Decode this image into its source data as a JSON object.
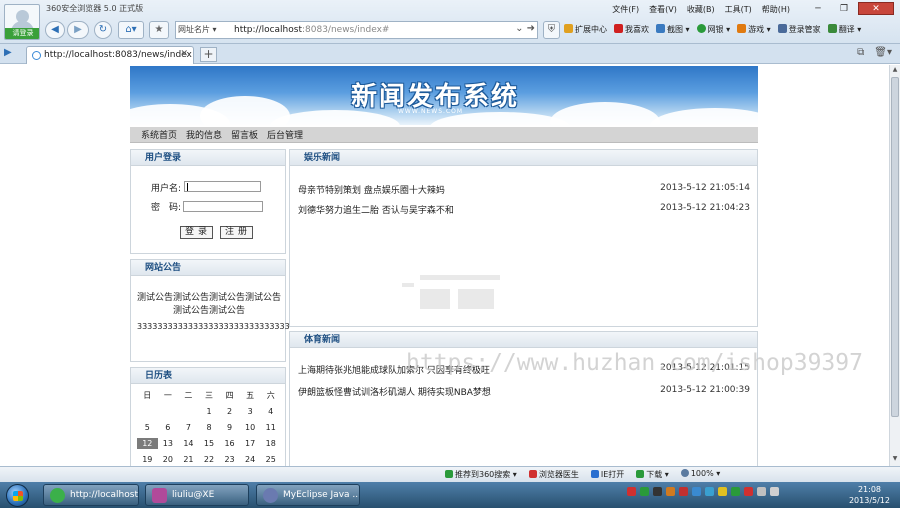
{
  "browser": {
    "login_badge": "请登录",
    "app_title": "360安全浏览器 5.0 正式版",
    "menus": [
      "文件(F)",
      "查看(V)",
      "收藏(B)",
      "工具(T)",
      "帮助(H)"
    ],
    "window_controls": [
      "─",
      "❐",
      "✕"
    ],
    "addr_sites": "网址名片 ▾",
    "url_host": "http://localhost",
    "url_rest": ":8083/news/index#",
    "toolbar": [
      "扩展中心",
      "我喜欢",
      "截图 ▾",
      "网银 ▾",
      "游戏 ▾",
      "登录管家",
      "翻译 ▾"
    ],
    "tab_label": "http://localhost:8083/news/index",
    "tab_close": "✕",
    "tab_new": "+"
  },
  "site": {
    "banner_title": "新闻发布系统",
    "banner_sub": "WWW.NEWS.COM",
    "nav": [
      "系统首页",
      "我的信息",
      "留言板",
      "后台管理"
    ]
  },
  "login": {
    "title": "用户登录",
    "username_label": "用户名:",
    "password_label": "密　码:",
    "login_btn": "登录",
    "register_btn": "注册"
  },
  "notice": {
    "title": "网站公告",
    "text": "测试公告测试公告测试公告测试公告测试公告测试公告",
    "number": "333333333333333333333333333333"
  },
  "calendar": {
    "title": "日历表",
    "headers": [
      "日",
      "一",
      "二",
      "三",
      "四",
      "五",
      "六"
    ],
    "days": [
      "",
      "",
      "",
      "1",
      "2",
      "3",
      "4",
      "5",
      "6",
      "7",
      "8",
      "9",
      "10",
      "11",
      "12",
      "13",
      "14",
      "15",
      "16",
      "17",
      "18",
      "19",
      "20",
      "21",
      "22",
      "23",
      "24",
      "25"
    ],
    "today": "12"
  },
  "entertainment": {
    "title": "娱乐新闻",
    "items": [
      {
        "title": "母亲节特别策划 盘点娱乐圈十大辣妈",
        "time": "2013-5-12 21:05:14"
      },
      {
        "title": "刘德华努力追生二胎 否认与吴宇森不和",
        "time": "2013-5-12 21:04:23"
      }
    ]
  },
  "sports": {
    "title": "体育新闻",
    "items": [
      {
        "title": "上海期待张兆旭能成球队加索尔 只因享有终极旺",
        "time": "2013-5-12 21:01:15"
      },
      {
        "title": "伊朗篮板怪曹试训洛杉矶湖人 期待实现NBA梦想",
        "time": "2013-5-12 21:00:39"
      }
    ]
  },
  "watermark": "https://www.huzhan.com/ishop39397",
  "statusbar": [
    "推荐到360搜索 ▾",
    "浏览器医生",
    "IE打开",
    "下载 ▾",
    "100% ▾"
  ],
  "taskbar": {
    "items": [
      "http://localhost...",
      "liuliu@XE",
      "MyEclipse Java ..."
    ],
    "time": "21:08",
    "date": "2013/5/12"
  },
  "colors": {
    "accent": "#1e4f82",
    "banner_sky": "#2f77c7",
    "nav_bg": "#d4d4d4",
    "taskbar": "#28506f"
  }
}
